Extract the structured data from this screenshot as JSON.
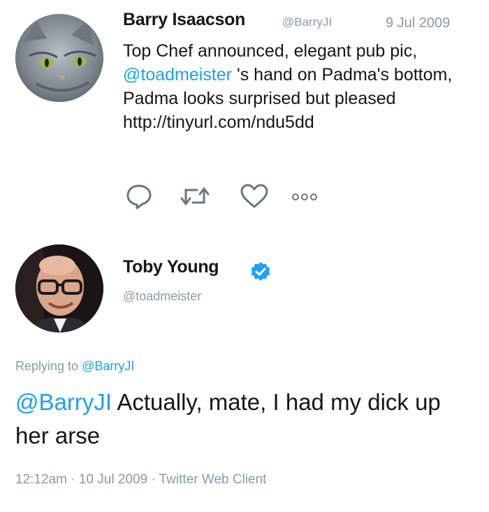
{
  "tweet1": {
    "author_name": "Barry Isaacson",
    "author_handle": "@BarryJI",
    "date": "9 Jul 2009",
    "text_before": "Top Chef announced, elegant pub pic, ",
    "mention": "@toadmeister",
    "text_after": " 's hand  on Padma's bottom, Padma looks surprised but pleased http://tinyurl.com/ndu5dd",
    "actions": [
      "reply",
      "retweet",
      "like",
      "more"
    ]
  },
  "tweet2": {
    "author_name": "Toby Young",
    "author_handle": "@toadmeister",
    "verified": true,
    "replying_prefix": "Replying to ",
    "replying_to": "@BarryJI",
    "mention": "@BarryJI",
    "text": " Actually, mate, I had my dick up her arse",
    "time": "12:12am",
    "date": "10 Jul 2009",
    "client": "Twitter Web Client",
    "separator": " · "
  },
  "colors": {
    "link": "#1da1f2",
    "muted": "#8899a6",
    "text": "#14171a",
    "verified": "#1da1f2"
  }
}
